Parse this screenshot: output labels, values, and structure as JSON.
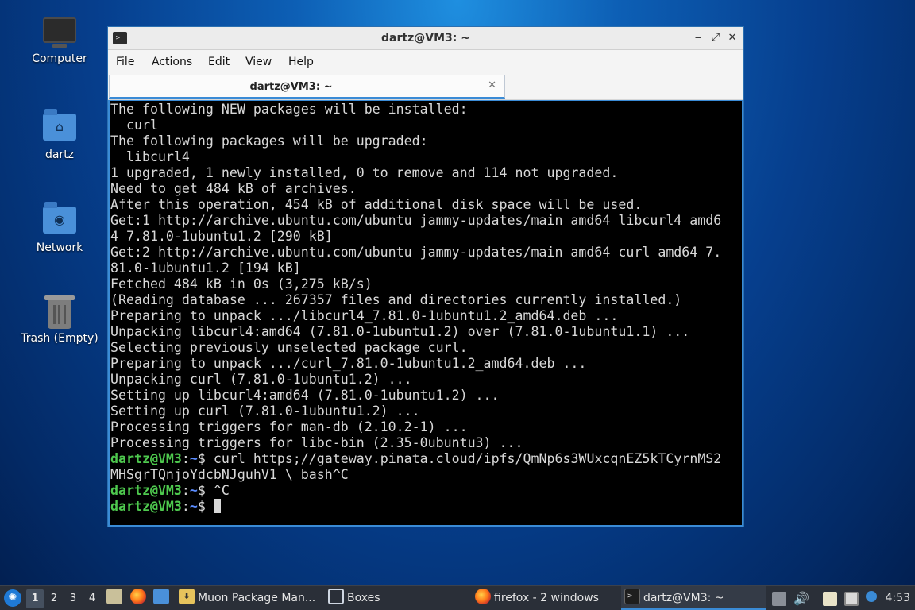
{
  "desktop": {
    "icons": [
      {
        "label": "Computer",
        "icon": "computer-icon"
      },
      {
        "label": "dartz",
        "icon": "home-folder-icon"
      },
      {
        "label": "Network",
        "icon": "network-folder-icon"
      },
      {
        "label": "Trash (Empty)",
        "icon": "trash-icon"
      }
    ]
  },
  "window": {
    "title": "dartz@VM3: ~",
    "controls": {
      "minimize": "‒",
      "maximize": "⤢",
      "close": "✕"
    },
    "menu": [
      "File",
      "Actions",
      "Edit",
      "View",
      "Help"
    ],
    "tab": {
      "title": "dartz@VM3: ~",
      "close": "✕"
    }
  },
  "terminal": {
    "output_lines": [
      "The following NEW packages will be installed:",
      "  curl",
      "The following packages will be upgraded:",
      "  libcurl4",
      "1 upgraded, 1 newly installed, 0 to remove and 114 not upgraded.",
      "Need to get 484 kB of archives.",
      "After this operation, 454 kB of additional disk space will be used.",
      "Get:1 http://archive.ubuntu.com/ubuntu jammy-updates/main amd64 libcurl4 amd6",
      "4 7.81.0-1ubuntu1.2 [290 kB]",
      "Get:2 http://archive.ubuntu.com/ubuntu jammy-updates/main amd64 curl amd64 7.",
      "81.0-1ubuntu1.2 [194 kB]",
      "Fetched 484 kB in 0s (3,275 kB/s)",
      "(Reading database ... 267357 files and directories currently installed.)",
      "Preparing to unpack .../libcurl4_7.81.0-1ubuntu1.2_amd64.deb ...",
      "Unpacking libcurl4:amd64 (7.81.0-1ubuntu1.2) over (7.81.0-1ubuntu1.1) ...",
      "Selecting previously unselected package curl.",
      "Preparing to unpack .../curl_7.81.0-1ubuntu1.2_amd64.deb ...",
      "Unpacking curl (7.81.0-1ubuntu1.2) ...",
      "Setting up libcurl4:amd64 (7.81.0-1ubuntu1.2) ...",
      "Setting up curl (7.81.0-1ubuntu1.2) ...",
      "Processing triggers for man-db (2.10.2-1) ...",
      "Processing triggers for libc-bin (2.35-0ubuntu3) ..."
    ],
    "prompt_user": "dartz@VM3",
    "prompt_sep": ":",
    "prompt_path": "~",
    "prompt_sym": "$ ",
    "cmd1_line1": "curl https;//gateway.pinata.cloud/ipfs/QmNp6s3WUxcqnEZ5kTCyrnMS2",
    "cmd1_line2": "MHSgrTQnjoYdcbNJguhV1 \\ bash^C",
    "cmd2": "^C",
    "cmd3": ""
  },
  "taskbar": {
    "menu_icon": "lubuntu-menu-icon",
    "workspaces": [
      "1",
      "2",
      "3",
      "4"
    ],
    "active_workspace": "1",
    "tasks": [
      {
        "label": "Muon Package Man...",
        "icon": "muon-package-manager-icon"
      },
      {
        "label": "Boxes",
        "icon": "boxes-icon"
      },
      {
        "label": "firefox - 2 windows",
        "icon": "firefox-icon"
      },
      {
        "label": "dartz@VM3: ~",
        "icon": "terminal-icon"
      }
    ],
    "clock": "4:53"
  }
}
